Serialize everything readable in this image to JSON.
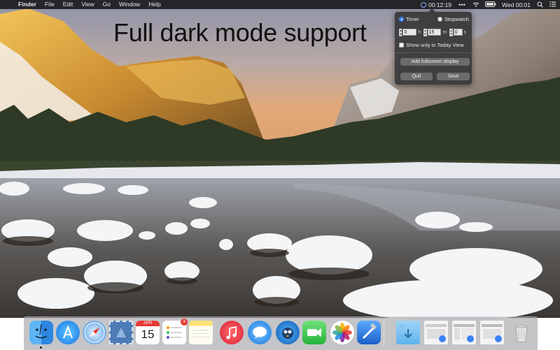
{
  "menubar": {
    "apple_glyph": "",
    "items": [
      "Finder",
      "File",
      "Edit",
      "View",
      "Go",
      "Window",
      "Help"
    ],
    "timer_readout": "00:12:19",
    "more_glyph": "•••",
    "clock": "Wed 00:01"
  },
  "headline": "Full dark mode support",
  "popover": {
    "mode_timer": "Timer",
    "mode_stopwatch": "Stopwatch",
    "selected_mode": "Timer",
    "hours_value": "0",
    "hours_unit": "h",
    "minutes_value": "15",
    "minutes_unit": "m",
    "seconds_value": "0",
    "seconds_unit": "s",
    "today_view_label": "Show only in Today View",
    "today_view_checked": false,
    "fullscreen_button": "Add fullscreen display",
    "quit_button": "Quit",
    "save_button": "Save"
  },
  "dock": {
    "calendar_month": "APR",
    "calendar_day": "15",
    "reminders_badge": "3",
    "apps": [
      "finder",
      "app-store",
      "safari",
      "mail-stamp",
      "calendar",
      "reminders",
      "notes",
      "music",
      "messages",
      "tweetbot",
      "facetime",
      "photos",
      "xcode",
      "downloads-folder",
      "window-preview-1",
      "window-preview-2",
      "window-preview-3",
      "trash"
    ]
  },
  "colors": {
    "accent": "#3b82f6",
    "menubar_bg": "#1c1c1e",
    "popover_bg": "#3a3a3c"
  }
}
